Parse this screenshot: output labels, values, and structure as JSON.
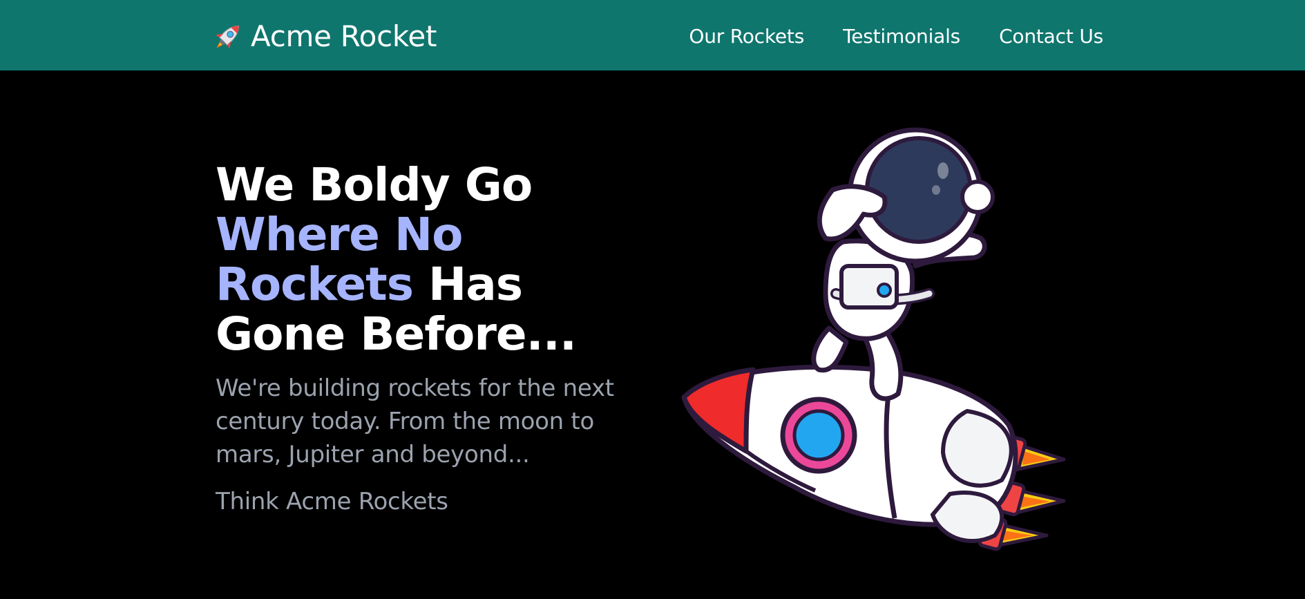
{
  "brand": {
    "name": "Acme Rocket",
    "icon": "rocket-icon"
  },
  "nav": {
    "links": [
      "Our Rockets",
      "Testimonials",
      "Contact Us"
    ]
  },
  "hero": {
    "title_line1": "We Boldy Go",
    "title_accent": "Where No Rockets",
    "title_rest": "Has Gone Before...",
    "description": "We're building rockets for the next century today. From the moon to mars, Jupiter and beyond...",
    "tagline": "Think Acme Rockets",
    "illustration": "astronaut-riding-rocket"
  },
  "colors": {
    "navbar": "#0f766e",
    "background": "#000000",
    "accent": "#a5b4fc",
    "muted_text": "#9ca3af"
  }
}
